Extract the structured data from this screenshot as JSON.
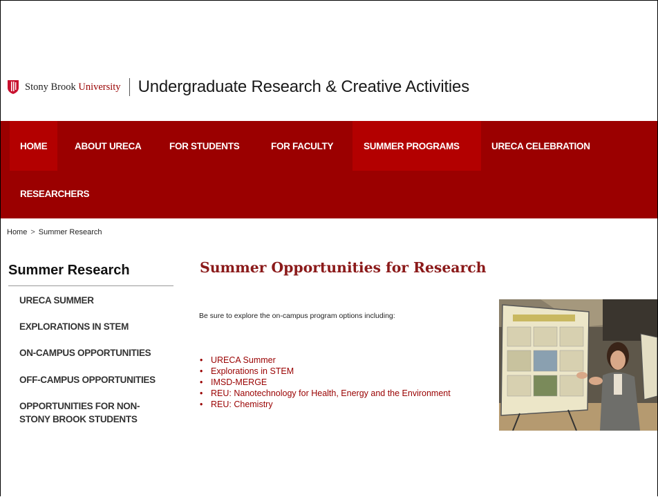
{
  "header": {
    "university_name_part1": "Stony Brook ",
    "university_name_part2": "University",
    "site_title": "Undergraduate Research & Creative Activities"
  },
  "nav": {
    "items": [
      {
        "label": "HOME"
      },
      {
        "label": "ABOUT URECA"
      },
      {
        "label": "FOR STUDENTS"
      },
      {
        "label": "FOR FACULTY"
      },
      {
        "label": "SUMMER PROGRAMS"
      },
      {
        "label": "URECA CELEBRATION"
      },
      {
        "label": "RESEARCHERS"
      }
    ]
  },
  "breadcrumb": {
    "home": "Home",
    "separator": ">",
    "current": "Summer Research"
  },
  "sidebar": {
    "title": "Summer Research",
    "items": [
      {
        "line1": "URECA SUMMER",
        "line2": ""
      },
      {
        "line1": "EXPLORATIONS IN STEM",
        "line2": ""
      },
      {
        "line1": "ON-CAMPUS OPPORTUNITIES",
        "line2": ""
      },
      {
        "line1": "OFF-CAMPUS OPPORTUNITIES",
        "line2": ""
      },
      {
        "line1": "OPPORTUNITIES FOR NON-",
        "line2": "STONY BROOK STUDENTS"
      }
    ]
  },
  "main": {
    "title": "Summer Opportunities for Research",
    "intro": "Be sure to explore the on-campus program options including:",
    "links": [
      "URECA Summer",
      "Explorations in STEM",
      "IMSD-MERGE",
      "REU: Nanotechnology for Health, Energy and the Environment",
      "REU: Chemistry"
    ]
  },
  "colors": {
    "brand_red": "#9b0000",
    "nav_active": "#b30000",
    "title_red": "#8b1a1a"
  }
}
